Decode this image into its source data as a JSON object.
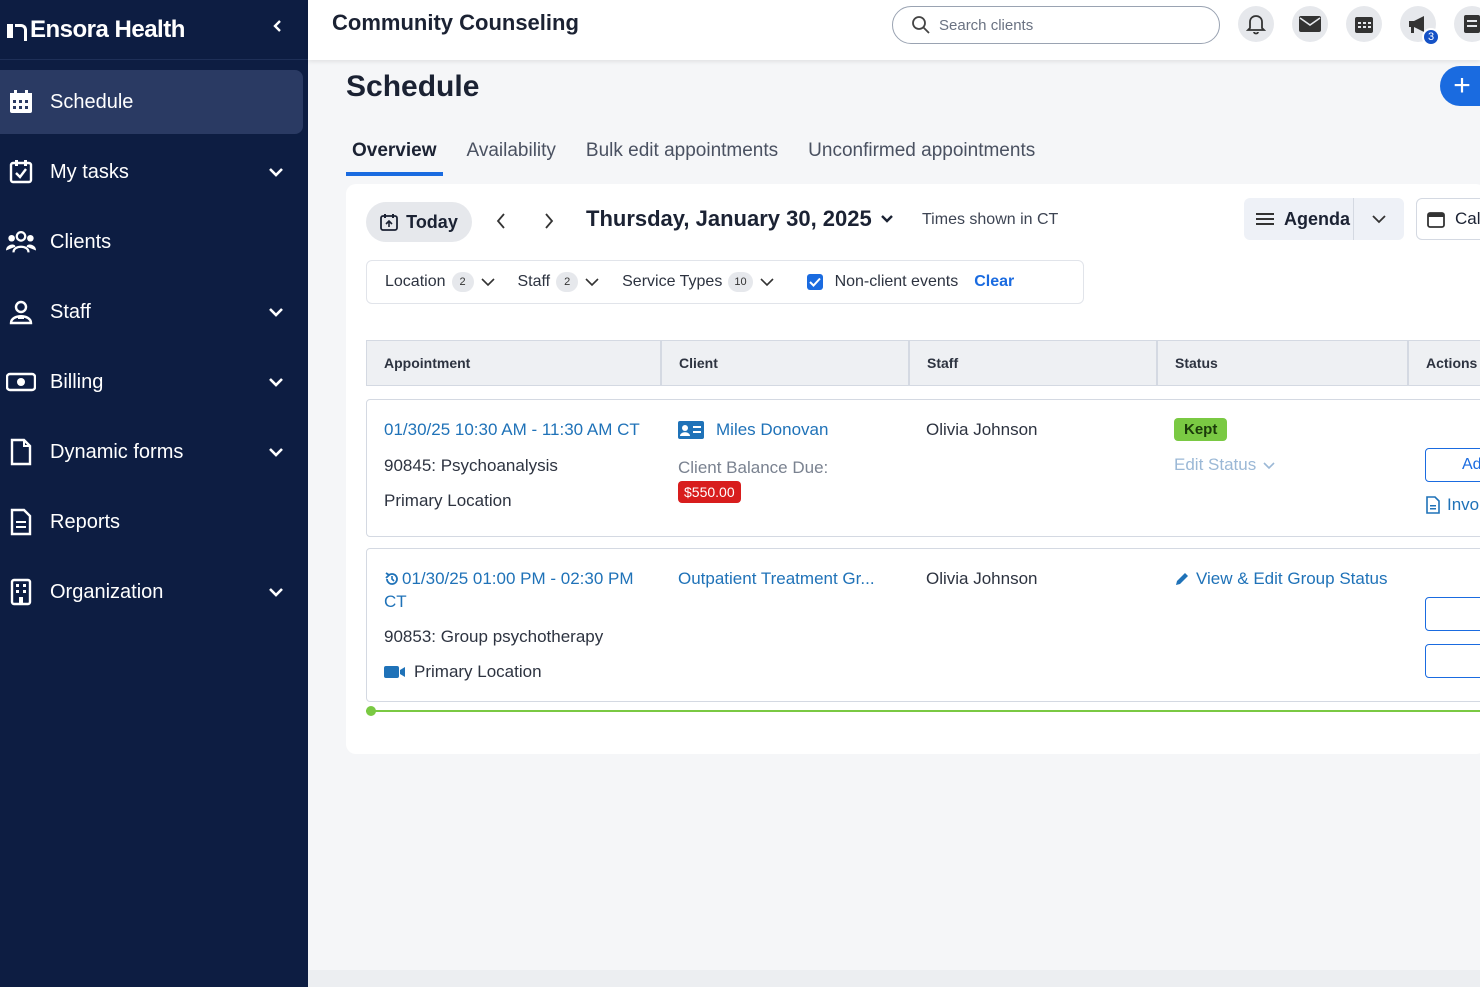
{
  "brand": {
    "name": "Ensora Health"
  },
  "sidebar": {
    "items": [
      {
        "label": "Schedule",
        "icon": "calendar-icon",
        "active": true,
        "expandable": false
      },
      {
        "label": "My tasks",
        "icon": "task-check-icon",
        "active": false,
        "expandable": true
      },
      {
        "label": "Clients",
        "icon": "clients-icon",
        "active": false,
        "expandable": false
      },
      {
        "label": "Staff",
        "icon": "staff-icon",
        "active": false,
        "expandable": true
      },
      {
        "label": "Billing",
        "icon": "billing-icon",
        "active": false,
        "expandable": true
      },
      {
        "label": "Dynamic forms",
        "icon": "form-icon",
        "active": false,
        "expandable": true
      },
      {
        "label": "Reports",
        "icon": "report-icon",
        "active": false,
        "expandable": false
      },
      {
        "label": "Organization",
        "icon": "building-icon",
        "active": false,
        "expandable": true
      }
    ]
  },
  "header": {
    "org_name": "Community Counseling",
    "search_placeholder": "Search clients",
    "notification_badge": "3"
  },
  "page": {
    "title": "Schedule",
    "fab_label": "+",
    "tabs": [
      {
        "label": "Overview",
        "active": true
      },
      {
        "label": "Availability",
        "active": false
      },
      {
        "label": "Bulk edit appointments",
        "active": false
      },
      {
        "label": "Unconfirmed appointments",
        "active": false
      }
    ]
  },
  "toolbar": {
    "today_label": "Today",
    "date_label": "Thursday, January 30, 2025",
    "timezone_note": "Times shown in CT",
    "view_label": "Agenda",
    "calendar_label": "Cale"
  },
  "filters": {
    "location_label": "Location",
    "location_count": "2",
    "staff_label": "Staff",
    "staff_count": "2",
    "service_label": "Service Types",
    "service_count": "10",
    "nonclient_label": "Non-client events",
    "nonclient_checked": true,
    "clear_label": "Clear"
  },
  "table": {
    "columns": [
      "Appointment",
      "Client",
      "Staff",
      "Status",
      "Actions"
    ],
    "rows": [
      {
        "time": "01/30/25 10:30 AM - 11:30 AM CT",
        "service": "90845: Psychoanalysis",
        "location": "Primary Location",
        "client": "Miles Donovan",
        "balance_label": "Client Balance Due:",
        "balance": "$550.00",
        "staff": "Olivia Johnson",
        "status": "Kept",
        "edit_status": "Edit Status",
        "action_1": "Ad",
        "action_2": "Invo"
      },
      {
        "time": "01/30/25 01:00 PM - 02:30 PM",
        "time_suffix": "CT",
        "service": "90853: Group psychotherapy",
        "location": "Primary Location",
        "client": "Outpatient Treatment Gr...",
        "staff": "Olivia Johnson",
        "status_link": "View & Edit Group Status"
      }
    ]
  },
  "colors": {
    "sidebar_bg": "#0d1d42",
    "accent": "#1a6be0",
    "kept": "#7ac943",
    "balance": "#d81d1d"
  }
}
